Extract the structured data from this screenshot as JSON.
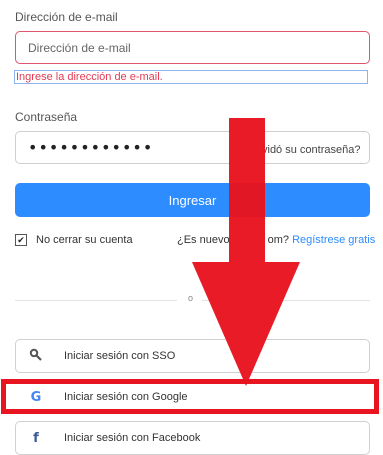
{
  "email": {
    "label": "Dirección de e-mail",
    "placeholder": "Dirección de e-mail",
    "error": "Ingrese la dirección de e-mail."
  },
  "password": {
    "label": "Contraseña",
    "masked_value": "••••••••••••",
    "forgot": "vidó su contraseña?"
  },
  "signin_button": "Ingresar",
  "keep_signed_in": {
    "label": "No cerrar su cuenta",
    "checked": true
  },
  "new_user": {
    "prefix": "¿Es nuevo",
    "middle": "om?",
    "link": "Regístrese gratis"
  },
  "divider_text": "o",
  "social": [
    {
      "label": "Iniciar sesión con SSO",
      "icon": "key-icon",
      "glyph": "🔍"
    },
    {
      "label": "Iniciar sesión con Google",
      "icon": "google-icon",
      "glyph": "G"
    },
    {
      "label": "Iniciar sesión con Facebook",
      "icon": "facebook-icon",
      "glyph": "f"
    }
  ],
  "colors": {
    "primary": "#2d8cff",
    "error": "#e23b54",
    "annotation_red": "#e8141f"
  }
}
